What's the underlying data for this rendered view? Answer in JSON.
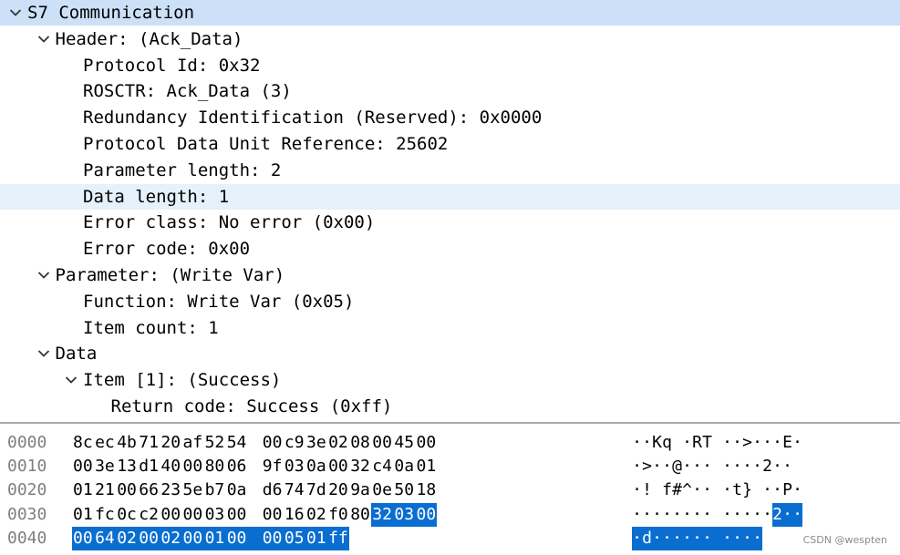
{
  "tree": [
    {
      "indent": 0,
      "arrow": "down",
      "text": "S7 Communication",
      "style": "sel-top"
    },
    {
      "indent": 1,
      "arrow": "down",
      "text": "Header: (Ack_Data)"
    },
    {
      "indent": 2,
      "arrow": null,
      "text": "Protocol Id: 0x32"
    },
    {
      "indent": 2,
      "arrow": null,
      "text": "ROSCTR: Ack_Data (3)"
    },
    {
      "indent": 2,
      "arrow": null,
      "text": "Redundancy Identification (Reserved): 0x0000"
    },
    {
      "indent": 2,
      "arrow": null,
      "text": "Protocol Data Unit Reference: 25602"
    },
    {
      "indent": 2,
      "arrow": null,
      "text": "Parameter length: 2"
    },
    {
      "indent": 2,
      "arrow": null,
      "text": "Data length: 1",
      "style": "sel-hl"
    },
    {
      "indent": 2,
      "arrow": null,
      "text": "Error class: No error (0x00)"
    },
    {
      "indent": 2,
      "arrow": null,
      "text": "Error code: 0x00"
    },
    {
      "indent": 1,
      "arrow": "down",
      "text": "Parameter: (Write Var)"
    },
    {
      "indent": 2,
      "arrow": null,
      "text": "Function: Write Var (0x05)"
    },
    {
      "indent": 2,
      "arrow": null,
      "text": "Item count: 1"
    },
    {
      "indent": 1,
      "arrow": "down",
      "text": "Data"
    },
    {
      "indent": 2,
      "arrow": "down",
      "text": "Item [1]: (Success)"
    },
    {
      "indent": 3,
      "arrow": null,
      "text": "Return code: Success (0xff)"
    }
  ],
  "hex_rows": [
    {
      "offset": "0000",
      "bytes": [
        "8c",
        "ec",
        "4b",
        "71",
        "20",
        "af",
        "52",
        "54",
        "00",
        "c9",
        "3e",
        "02",
        "08",
        "00",
        "45",
        "00"
      ],
      "ascii": [
        "·",
        "·",
        "K",
        "q",
        " ",
        "·",
        "R",
        "T",
        " ",
        "·",
        "·",
        ">",
        "·",
        "·",
        "·",
        "E",
        "·"
      ],
      "hl_start": -1,
      "hl_end": -1,
      "ascii_hl_start": -1,
      "ascii_hl_end": -1
    },
    {
      "offset": "0010",
      "bytes": [
        "00",
        "3e",
        "13",
        "d1",
        "40",
        "00",
        "80",
        "06",
        "9f",
        "03",
        "0a",
        "00",
        "32",
        "c4",
        "0a",
        "01"
      ],
      "ascii": [
        "·",
        ">",
        "·",
        "·",
        "@",
        "·",
        "·",
        "·",
        " ",
        "·",
        "·",
        "·",
        "·",
        "2",
        "·",
        "·"
      ],
      "hl_start": -1,
      "hl_end": -1,
      "ascii_hl_start": -1,
      "ascii_hl_end": -1
    },
    {
      "offset": "0020",
      "bytes": [
        "01",
        "21",
        "00",
        "66",
        "23",
        "5e",
        "b7",
        "0a",
        "d6",
        "74",
        "7d",
        "20",
        "9a",
        "0e",
        "50",
        "18"
      ],
      "ascii": [
        "·",
        "!",
        " ",
        "f",
        "#",
        "^",
        "·",
        "·",
        " ",
        "·",
        "t",
        "}",
        " ",
        "·",
        "·",
        "P",
        "·"
      ],
      "hl_start": -1,
      "hl_end": -1,
      "ascii_hl_start": -1,
      "ascii_hl_end": -1
    },
    {
      "offset": "0030",
      "bytes": [
        "01",
        "fc",
        "0c",
        "c2",
        "00",
        "00",
        "03",
        "00",
        "00",
        "16",
        "02",
        "f0",
        "80",
        "32",
        "03",
        "00"
      ],
      "ascii": [
        "·",
        "·",
        "·",
        "·",
        "·",
        "·",
        "·",
        "·",
        " ",
        "·",
        "·",
        "·",
        "·",
        "·",
        "2",
        "·",
        "·"
      ],
      "hl_start": 13,
      "hl_end": 15,
      "ascii_hl_start": 14,
      "ascii_hl_end": 16
    },
    {
      "offset": "0040",
      "bytes": [
        "00",
        "64",
        "02",
        "00",
        "02",
        "00",
        "01",
        "00",
        "00",
        "05",
        "01",
        "ff"
      ],
      "ascii": [
        "·",
        "d",
        "·",
        "·",
        "·",
        "·",
        "·",
        "·",
        " ",
        "·",
        "·",
        "·",
        "·"
      ],
      "hl_start": 0,
      "hl_end": 11,
      "ascii_hl_start": 0,
      "ascii_hl_end": 12
    }
  ],
  "watermark": "CSDN @wespten",
  "colors": {
    "selected_row": "#cce0f7",
    "hover_row": "#e5f1fb",
    "highlight": "#0a6ed1"
  }
}
